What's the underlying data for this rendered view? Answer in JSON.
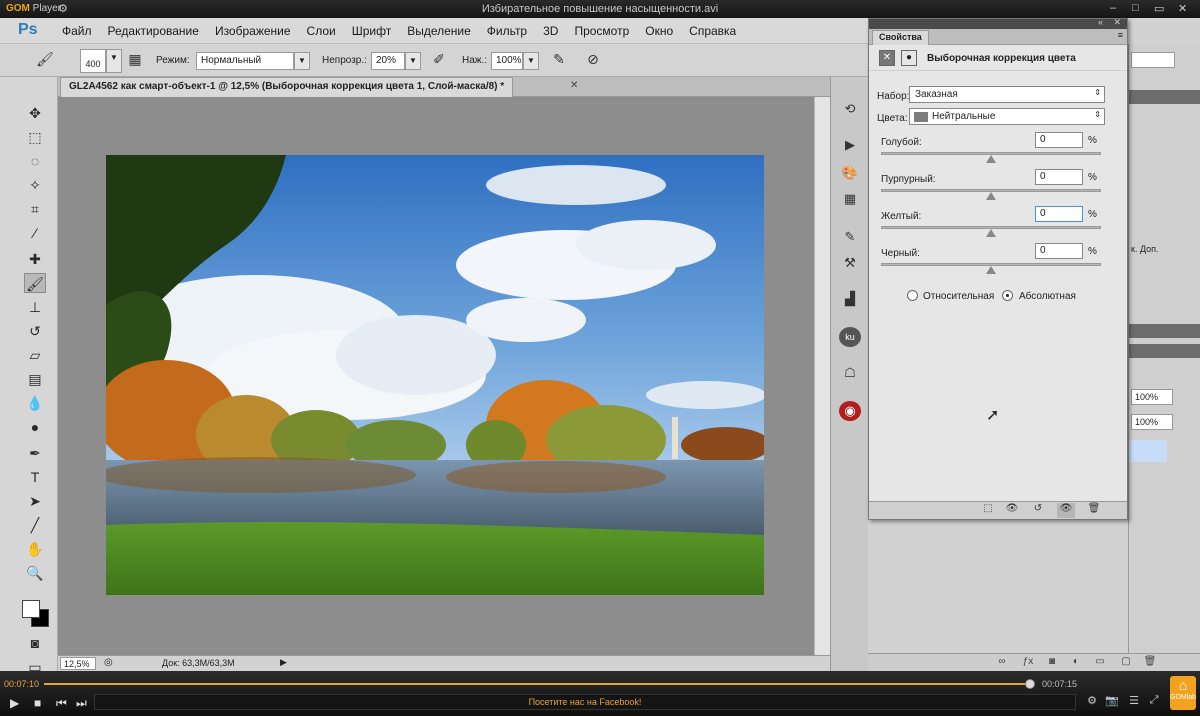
{
  "player": {
    "logo_a": "GOM",
    "logo_b": "Player",
    "title": "Избирательное повышение насыщенности.avi",
    "time_current": "00:07:10",
    "time_total": "00:07:15",
    "progress": 0.996,
    "banner": "Посетите нас на Facebook!",
    "brand": "GOMlab"
  },
  "menu": {
    "logo": "Ps",
    "items": [
      "Файл",
      "Редактирование",
      "Изображение",
      "Слои",
      "Шрифт",
      "Выделение",
      "Фильтр",
      "3D",
      "Просмотр",
      "Окно",
      "Справка"
    ]
  },
  "options": {
    "brush_size": "400",
    "mode_label": "Режим:",
    "mode_value": "Нормальный",
    "opacity_label": "Непрозр.:",
    "opacity_value": "20%",
    "pressure_label": "Наж.:",
    "pressure_value": "100%"
  },
  "document": {
    "tab_title": "GL2A4562 как смарт-объект-1 @ 12,5% (Выборочная коррекция цвета 1, Слой-маска/8) *",
    "zoom": "12,5%",
    "doc_size": "Док: 63,3M/63,3M"
  },
  "properties": {
    "tab": "Свойства",
    "title": "Выборочная коррекция цвета",
    "preset_label": "Набор:",
    "preset_value": "Заказная",
    "colors_label": "Цвета:",
    "colors_value": "Нейтральные",
    "sliders": [
      {
        "label": "Голубой:",
        "value": "0",
        "percent": 50
      },
      {
        "label": "Пурпурный:",
        "value": "0",
        "percent": 50
      },
      {
        "label": "Желтый:",
        "value": "0",
        "percent": 50
      },
      {
        "label": "Черный:",
        "value": "0",
        "percent": 50
      }
    ],
    "pct_sign": "%",
    "radio_relative": "Относительная",
    "radio_absolute": "Абсолютная",
    "radio_selected": "absolute"
  },
  "right_panel": {
    "snippet": "к. Доп.",
    "zoom_a": "100%",
    "zoom_b": "100%"
  },
  "colors": {
    "accent": "#e9a23b",
    "ps_blue": "#2d7dbf"
  }
}
